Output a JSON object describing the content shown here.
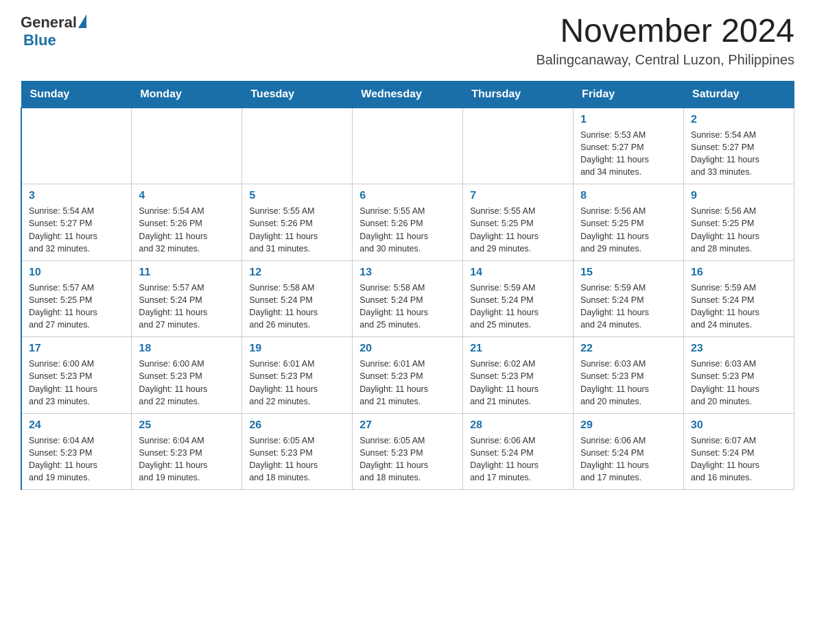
{
  "header": {
    "logo_general": "General",
    "logo_blue": "Blue",
    "month_title": "November 2024",
    "location": "Balingcanaway, Central Luzon, Philippines"
  },
  "weekdays": [
    "Sunday",
    "Monday",
    "Tuesday",
    "Wednesday",
    "Thursday",
    "Friday",
    "Saturday"
  ],
  "weeks": [
    [
      {
        "day": "",
        "info": ""
      },
      {
        "day": "",
        "info": ""
      },
      {
        "day": "",
        "info": ""
      },
      {
        "day": "",
        "info": ""
      },
      {
        "day": "",
        "info": ""
      },
      {
        "day": "1",
        "info": "Sunrise: 5:53 AM\nSunset: 5:27 PM\nDaylight: 11 hours\nand 34 minutes."
      },
      {
        "day": "2",
        "info": "Sunrise: 5:54 AM\nSunset: 5:27 PM\nDaylight: 11 hours\nand 33 minutes."
      }
    ],
    [
      {
        "day": "3",
        "info": "Sunrise: 5:54 AM\nSunset: 5:27 PM\nDaylight: 11 hours\nand 32 minutes."
      },
      {
        "day": "4",
        "info": "Sunrise: 5:54 AM\nSunset: 5:26 PM\nDaylight: 11 hours\nand 32 minutes."
      },
      {
        "day": "5",
        "info": "Sunrise: 5:55 AM\nSunset: 5:26 PM\nDaylight: 11 hours\nand 31 minutes."
      },
      {
        "day": "6",
        "info": "Sunrise: 5:55 AM\nSunset: 5:26 PM\nDaylight: 11 hours\nand 30 minutes."
      },
      {
        "day": "7",
        "info": "Sunrise: 5:55 AM\nSunset: 5:25 PM\nDaylight: 11 hours\nand 29 minutes."
      },
      {
        "day": "8",
        "info": "Sunrise: 5:56 AM\nSunset: 5:25 PM\nDaylight: 11 hours\nand 29 minutes."
      },
      {
        "day": "9",
        "info": "Sunrise: 5:56 AM\nSunset: 5:25 PM\nDaylight: 11 hours\nand 28 minutes."
      }
    ],
    [
      {
        "day": "10",
        "info": "Sunrise: 5:57 AM\nSunset: 5:25 PM\nDaylight: 11 hours\nand 27 minutes."
      },
      {
        "day": "11",
        "info": "Sunrise: 5:57 AM\nSunset: 5:24 PM\nDaylight: 11 hours\nand 27 minutes."
      },
      {
        "day": "12",
        "info": "Sunrise: 5:58 AM\nSunset: 5:24 PM\nDaylight: 11 hours\nand 26 minutes."
      },
      {
        "day": "13",
        "info": "Sunrise: 5:58 AM\nSunset: 5:24 PM\nDaylight: 11 hours\nand 25 minutes."
      },
      {
        "day": "14",
        "info": "Sunrise: 5:59 AM\nSunset: 5:24 PM\nDaylight: 11 hours\nand 25 minutes."
      },
      {
        "day": "15",
        "info": "Sunrise: 5:59 AM\nSunset: 5:24 PM\nDaylight: 11 hours\nand 24 minutes."
      },
      {
        "day": "16",
        "info": "Sunrise: 5:59 AM\nSunset: 5:24 PM\nDaylight: 11 hours\nand 24 minutes."
      }
    ],
    [
      {
        "day": "17",
        "info": "Sunrise: 6:00 AM\nSunset: 5:23 PM\nDaylight: 11 hours\nand 23 minutes."
      },
      {
        "day": "18",
        "info": "Sunrise: 6:00 AM\nSunset: 5:23 PM\nDaylight: 11 hours\nand 22 minutes."
      },
      {
        "day": "19",
        "info": "Sunrise: 6:01 AM\nSunset: 5:23 PM\nDaylight: 11 hours\nand 22 minutes."
      },
      {
        "day": "20",
        "info": "Sunrise: 6:01 AM\nSunset: 5:23 PM\nDaylight: 11 hours\nand 21 minutes."
      },
      {
        "day": "21",
        "info": "Sunrise: 6:02 AM\nSunset: 5:23 PM\nDaylight: 11 hours\nand 21 minutes."
      },
      {
        "day": "22",
        "info": "Sunrise: 6:03 AM\nSunset: 5:23 PM\nDaylight: 11 hours\nand 20 minutes."
      },
      {
        "day": "23",
        "info": "Sunrise: 6:03 AM\nSunset: 5:23 PM\nDaylight: 11 hours\nand 20 minutes."
      }
    ],
    [
      {
        "day": "24",
        "info": "Sunrise: 6:04 AM\nSunset: 5:23 PM\nDaylight: 11 hours\nand 19 minutes."
      },
      {
        "day": "25",
        "info": "Sunrise: 6:04 AM\nSunset: 5:23 PM\nDaylight: 11 hours\nand 19 minutes."
      },
      {
        "day": "26",
        "info": "Sunrise: 6:05 AM\nSunset: 5:23 PM\nDaylight: 11 hours\nand 18 minutes."
      },
      {
        "day": "27",
        "info": "Sunrise: 6:05 AM\nSunset: 5:23 PM\nDaylight: 11 hours\nand 18 minutes."
      },
      {
        "day": "28",
        "info": "Sunrise: 6:06 AM\nSunset: 5:24 PM\nDaylight: 11 hours\nand 17 minutes."
      },
      {
        "day": "29",
        "info": "Sunrise: 6:06 AM\nSunset: 5:24 PM\nDaylight: 11 hours\nand 17 minutes."
      },
      {
        "day": "30",
        "info": "Sunrise: 6:07 AM\nSunset: 5:24 PM\nDaylight: 11 hours\nand 16 minutes."
      }
    ]
  ]
}
